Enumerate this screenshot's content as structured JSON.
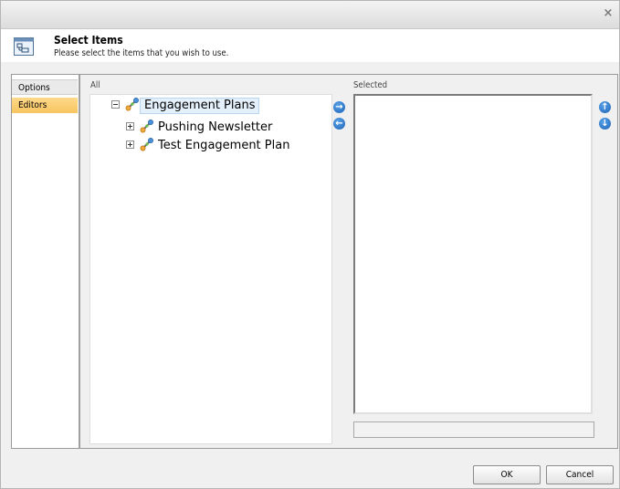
{
  "dialog": {
    "close_icon": "×",
    "title": "Select Items",
    "subtitle": "Please select the items that you wish to use."
  },
  "sidebar": {
    "tabs": [
      {
        "label": "Options",
        "selected": false
      },
      {
        "label": "Editors",
        "selected": true
      }
    ]
  },
  "all_panel": {
    "label": "All",
    "tree": {
      "root": {
        "label": "Engagement Plans",
        "expanded": true,
        "icon": "engagement-plan-icon"
      },
      "children": [
        {
          "label": "Pushing Newsletter",
          "expanded": false,
          "icon": "engagement-plan-icon"
        },
        {
          "label": "Test Engagement Plan",
          "expanded": false,
          "icon": "engagement-plan-icon"
        }
      ]
    }
  },
  "selected_panel": {
    "label": "Selected",
    "items": []
  },
  "arrows": {
    "add": "→",
    "remove": "←",
    "up": "↑",
    "down": "↓"
  },
  "footer": {
    "ok_label": "OK",
    "cancel_label": "Cancel"
  },
  "colors": {
    "accent_tab": "#f7c560",
    "arrow_button": "#1c63b5",
    "tree_highlight": "#e4f0fb"
  }
}
